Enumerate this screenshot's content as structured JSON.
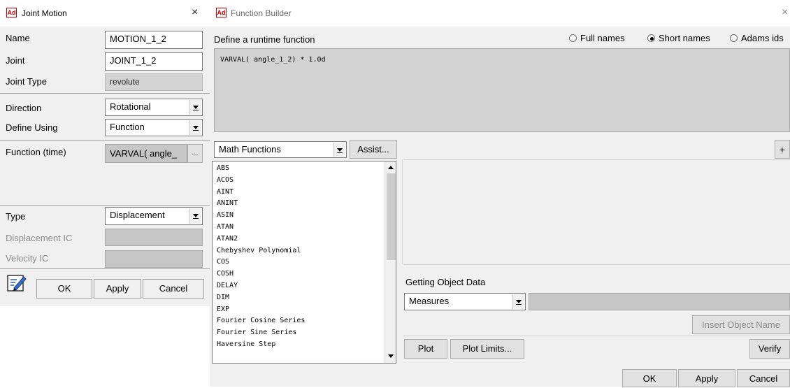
{
  "joint_motion": {
    "icon_text": "Ad",
    "title": "Joint Motion",
    "close_glyph": "×",
    "name_label": "Name",
    "name_value": "MOTION_1_2",
    "joint_label": "Joint",
    "joint_value": "JOINT_1_2",
    "joint_type_label": "Joint Type",
    "joint_type_value": "revolute",
    "direction_label": "Direction",
    "direction_value": "Rotational",
    "define_using_label": "Define Using",
    "define_using_value": "Function",
    "function_label": "Function (time)",
    "function_value": "VARVAL( angle_",
    "ellipsis_label": "...",
    "type_label": "Type",
    "type_value": "Displacement",
    "displacement_ic_label": "Displacement IC",
    "velocity_ic_label": "Velocity IC",
    "ok_label": "OK",
    "apply_label": "Apply",
    "cancel_label": "Cancel"
  },
  "function_builder": {
    "icon_text": "Ad",
    "title": "Function Builder",
    "close_glyph": "×",
    "define_label": "Define a runtime function",
    "name_options": [
      {
        "label": "Full names",
        "selected": false
      },
      {
        "label": "Short names",
        "selected": true
      },
      {
        "label": "Adams ids",
        "selected": false
      }
    ],
    "expression": "VARVAL( angle_1_2) * 1.0d",
    "category_value": "Math Functions",
    "assist_label": "Assist...",
    "plus_label": "+",
    "functions": [
      "ABS",
      "ACOS",
      "AINT",
      "ANINT",
      "ASIN",
      "ATAN",
      "ATAN2",
      "Chebyshev Polynomial",
      "COS",
      "COSH",
      "DELAY",
      "DIM",
      "EXP",
      "Fourier Cosine Series",
      "Fourier Sine Series",
      "Haversine Step"
    ],
    "getting_object_label": "Getting Object Data",
    "object_type_value": "Measures",
    "insert_object_label": "Insert Object Name",
    "plot_label": "Plot",
    "plot_limits_label": "Plot Limits...",
    "verify_label": "Verify",
    "ok_label": "OK",
    "apply_label": "Apply",
    "cancel_label": "Cancel"
  }
}
